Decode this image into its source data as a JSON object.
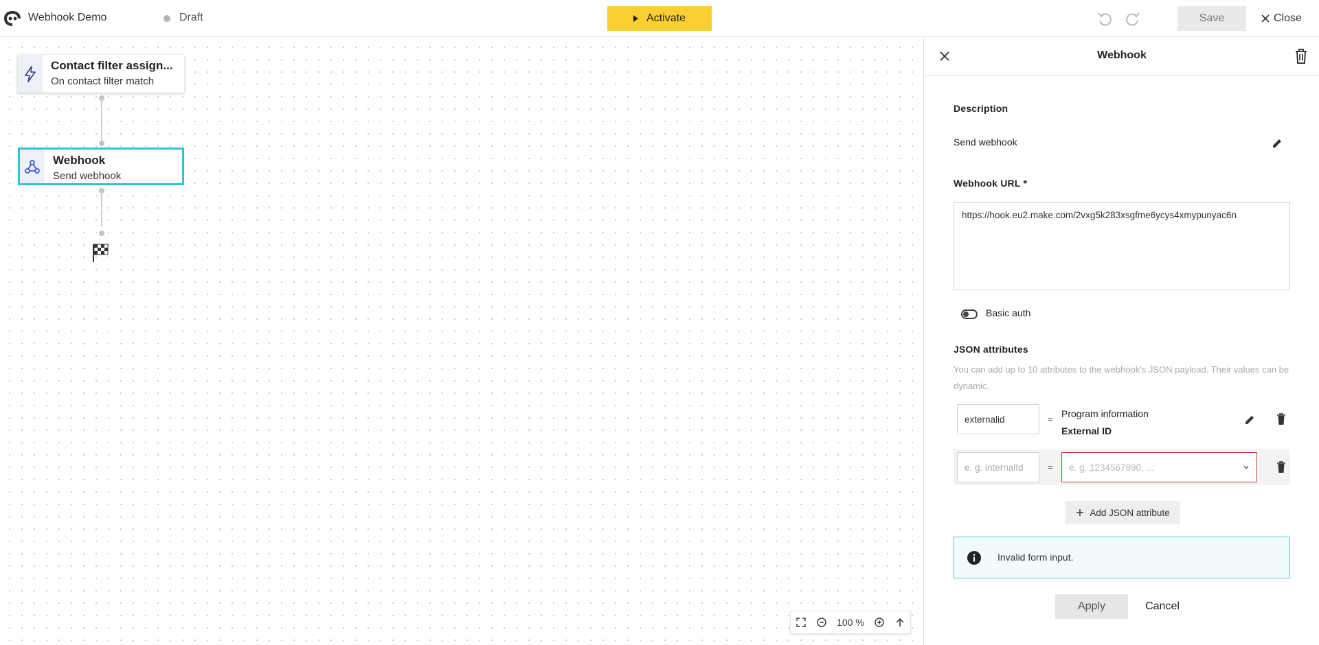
{
  "topbar": {
    "title": "Webhook Demo",
    "status": "Draft",
    "activate_label": "Activate",
    "save_label": "Save",
    "close_label": "Close"
  },
  "canvas": {
    "nodes": [
      {
        "title": "Contact filter assign...",
        "subtitle": "On contact filter match",
        "icon": "lightning-icon"
      },
      {
        "title": "Webhook",
        "subtitle": "Send webhook",
        "icon": "webhook-icon"
      }
    ],
    "zoom": "100 %"
  },
  "panel": {
    "title": "Webhook",
    "description_label": "Description",
    "description_value": "Send webhook",
    "url_label": "Webhook URL *",
    "url_value": "https://hook.eu2.make.com/2vxg5k283xsgfme6ycys4xmypunyac6n",
    "basic_auth_label": "Basic auth",
    "json_label": "JSON attributes",
    "json_hint": "You can add up to 10 attributes to the webhook's JSON payload. Their values can be dynamic.",
    "attributes": [
      {
        "key": "externalid",
        "value_group": "Program information",
        "value_name": "External ID"
      }
    ],
    "new_attr_key_placeholder": "e. g. internalId",
    "new_attr_value_placeholder": "e. g. 1234567890, ...",
    "equals": "=",
    "add_attr_label": "Add JSON attribute",
    "alert_text": "Invalid form input.",
    "apply_label": "Apply",
    "cancel_label": "Cancel"
  },
  "colors": {
    "accent": "#f9cf33",
    "selection": "#32c0dd",
    "error": "#d53a3a",
    "alert_bg": "#f1fbfd"
  }
}
